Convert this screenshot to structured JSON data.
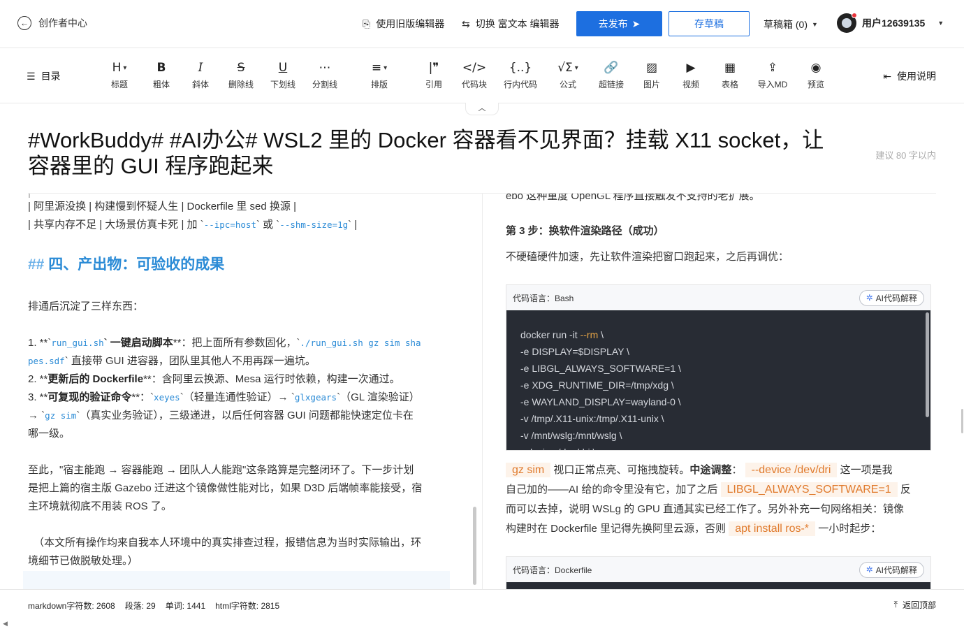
{
  "header": {
    "back_label": "创作者中心",
    "old_editor_label": "使用旧版编辑器",
    "switch_rich_label": "切换 富文本 编辑器",
    "publish_label": "去发布",
    "save_draft_label": "存草稿",
    "drafts_label": "草稿箱 (0)",
    "username": "用户12639135",
    "accent_color": "#1d6fe0"
  },
  "toolbar": {
    "toc_label": "目录",
    "help_label": "使用说明",
    "tools": [
      {
        "label": "标题",
        "glyph": "H",
        "icon": "heading-icon"
      },
      {
        "label": "粗体",
        "glyph": "B",
        "icon": "bold-icon"
      },
      {
        "label": "斜体",
        "glyph": "I",
        "icon": "italic-icon"
      },
      {
        "label": "删除线",
        "glyph": "S",
        "icon": "strikethrough-icon"
      },
      {
        "label": "下划线",
        "glyph": "U",
        "icon": "underline-icon"
      },
      {
        "label": "分割线",
        "glyph": "⋯",
        "icon": "divider-icon"
      },
      {
        "label": "排版",
        "glyph": "≡",
        "icon": "layout-icon"
      },
      {
        "label": "引用",
        "glyph": "|❞",
        "icon": "quote-icon"
      },
      {
        "label": "代码块",
        "glyph": "</>",
        "icon": "code-block-icon"
      },
      {
        "label": "行内代码",
        "glyph": "{..}",
        "icon": "inline-code-icon"
      },
      {
        "label": "公式",
        "glyph": "√Σ",
        "icon": "formula-icon"
      },
      {
        "label": "超链接",
        "glyph": "🔗",
        "icon": "link-icon"
      },
      {
        "label": "图片",
        "glyph": "▨",
        "icon": "image-icon"
      },
      {
        "label": "视频",
        "glyph": "▶",
        "icon": "video-icon"
      },
      {
        "label": "表格",
        "glyph": "▦",
        "icon": "table-icon"
      },
      {
        "label": "导入MD",
        "glyph": "⇪",
        "icon": "import-md-icon"
      },
      {
        "label": "预览",
        "glyph": "◉",
        "icon": "preview-icon"
      }
    ]
  },
  "article": {
    "title_line1": "#WorkBuddy# #AI办公# WSL2 里的 Docker 容器看不见界面？挂载 X11 socket，让",
    "title_line2": "容器里的 GUI 程序跑起来",
    "title_hint": "建议 80 字以内"
  },
  "editor": {
    "row1a": "| 阿里源没换 | 构建慢到怀疑人生 | Dockerfile 里 sed 换源 |",
    "row2a": "| 共享内存不足 | 大场景仿真卡死 | 加 `",
    "row2b": "--ipc=host",
    "row2c": "` 或 `",
    "row2d": "--shm-size=1g",
    "row2e": "` |",
    "h2_mark": "##",
    "h2_text": " 四、产出物：可验收的成果",
    "intro": "排通后沉淀了三样东西：",
    "item1_pre": "1. **`",
    "item1_code": "run_gui.sh",
    "item1_bold": "` 一键启动脚本",
    "item1_rest": "**：把上面所有参数固化，`",
    "item1_code2": "./run_gui.sh gz sim sha",
    "item1_code3": "pes.sdf",
    "item1_rest2": "` 直接带 GUI 进容器，团队里其他人不用再踩一遍坑。",
    "item2_pre": "2. **",
    "item2_bold": "更新后的 Dockerfile",
    "item2_rest": "**：含阿里云换源、Mesa 运行时依赖，构建一次通过。",
    "item3_pre": "3. **",
    "item3_bold": "可复现的验证命令",
    "item3_a": "**：`",
    "item3_c1": "xeyes",
    "item3_b": "`（轻量连通性验证）→ `",
    "item3_c2": "glxgears",
    "item3_c": "`（GL 渲染验证）",
    "item3_d": "→ `",
    "item3_c3": "gz sim",
    "item3_e": "`（真实业务验证），三级递进，以后任何容器 GUI 问题都能快速定位卡在",
    "item3_f": "哪一级。",
    "para1": "至此，\"宿主能跑 → 容器能跑 → 团队人人能跑\"这条路算是完整闭环了。下一步计划",
    "para2": "是把上篇的宿主版 Gazebo 迁进这个镜像做性能对比，如果 D3D 后端帧率能接受，宿",
    "para3": "主环境就彻底不用装 ROS 了。",
    "note1": "（本文所有操作均来自我本人环境中的真实排查过程，报错信息为当时实际输出，环",
    "note2": "境细节已做脱敏处理。）"
  },
  "preview": {
    "cut_text": "ebo 这种重度 OpenGL 程序直接触发不支持的老扩展。",
    "step3_title": "第 3 步：换软件渲染路径（成功）",
    "step3_desc": "不硬磕硬件加速，先让软件渲染把窗口跑起来，之后再调优：",
    "code1": {
      "lang_label": "代码语言：Bash",
      "ai_label": "AI代码解释",
      "lines": [
        "docker run -it ",
        "  -e DISPLAY=$DISPLAY \\",
        "  -e LIBGL_ALWAYS_SOFTWARE=1 \\",
        "  -e XDG_RUNTIME_DIR=/tmp/xdg \\",
        "  -e WAYLAND_DISPLAY=wayland-0 \\",
        "  -v /tmp/.X11-unix:/tmp/.X11-unix \\",
        "  -v /mnt/wslg:/mnt/wslg \\",
        "  --device /dev/dri \\"
      ],
      "kw": "--rm",
      "kw_tail": " \\"
    },
    "body_tag1": "gz sim",
    "body_a": " 视口正常点亮、可拖拽旋转。",
    "body_bold": "中途调整",
    "body_b": "：",
    "body_tag2": "--device /dev/dri",
    "body_c": " 这一项是我",
    "body_d": "自己加的——AI 给的命令里没有它，加了之后 ",
    "body_tag3": "LIBGL_ALWAYS_SOFTWARE=1",
    "body_e": " 反",
    "body_f": "而可以去掉，说明 WSLg 的 GPU 直通其实已经工作了。另外补充一句网络相关：镜像",
    "body_g": "构建时在 Dockerfile 里记得先换阿里云源，否则 ",
    "body_tag4": "apt install ros-*",
    "body_h": " 一小时起步：",
    "code2": {
      "lang_label": "代码语言：Dockerfile",
      "ai_label": "AI代码解释"
    }
  },
  "footer": {
    "markdown_count": "markdown字符数: 2608",
    "paragraphs": "段落: 29",
    "words": "单词: 1441",
    "html_count": "html字符数: 2815",
    "back_top": "返回顶部"
  }
}
